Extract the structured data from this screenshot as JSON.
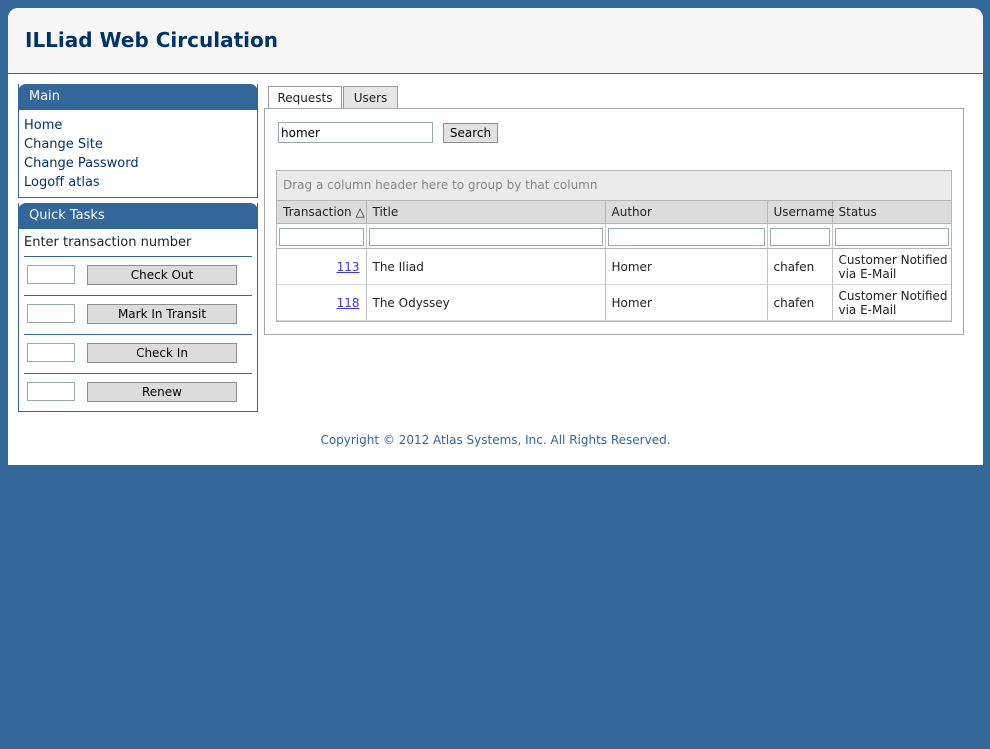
{
  "app_title": "ILLiad Web Circulation",
  "main_box": {
    "title": "Main",
    "links": [
      "Home",
      "Change Site",
      "Change Password",
      "Logoff atlas"
    ]
  },
  "quick_tasks": {
    "title": "Quick Tasks",
    "label": "Enter transaction number",
    "buttons": [
      "Check Out",
      "Mark In Transit",
      "Check In",
      "Renew"
    ]
  },
  "tabs": [
    "Requests",
    "Users"
  ],
  "search": {
    "value": "homer",
    "button": "Search"
  },
  "grid": {
    "group_hint": "Drag a column header here to group by that column",
    "columns": [
      "Transaction",
      "Title",
      "Author",
      "Username",
      "Status"
    ],
    "sort_indicator": "△",
    "rows": [
      {
        "transaction": "113",
        "title": "The Iliad",
        "author": "Homer",
        "username": "chafen",
        "status_line1": "Customer Notified",
        "status_line2": "via E-Mail"
      },
      {
        "transaction": "118",
        "title": "The Odyssey",
        "author": "Homer",
        "username": "chafen",
        "status_line1": "Customer Notified",
        "status_line2": "via E-Mail"
      }
    ]
  },
  "footer": "Copyright © 2012 Atlas Systems, Inc. All Rights Reserved.",
  "colors": {
    "brand": "#336699",
    "title": "#003366",
    "link": "#3b3bd1"
  }
}
